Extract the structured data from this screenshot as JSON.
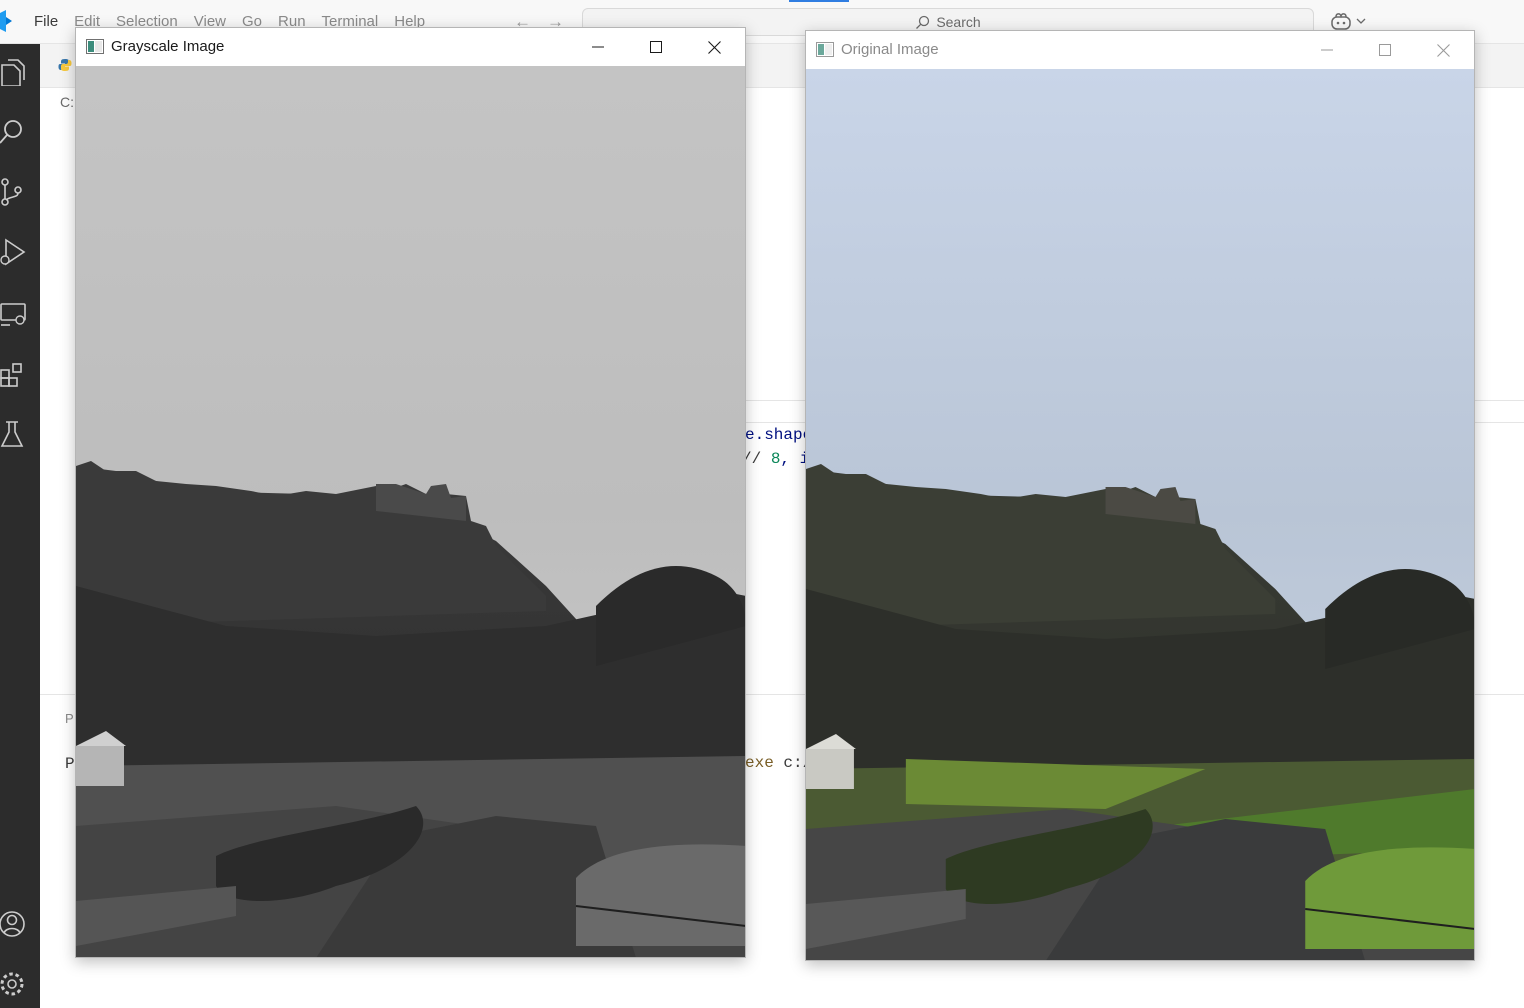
{
  "vscode": {
    "menu": [
      {
        "label": "File",
        "dim": false
      },
      {
        "label": "Edit",
        "dim": true
      },
      {
        "label": "Selection",
        "dim": true
      },
      {
        "label": "View",
        "dim": true
      },
      {
        "label": "Go",
        "dim": true
      },
      {
        "label": "Run",
        "dim": true
      },
      {
        "label": "Terminal",
        "dim": true
      },
      {
        "label": "Help",
        "dim": true
      }
    ],
    "back_arrow": "←",
    "forward_arrow": "→",
    "search_placeholder": "Search",
    "breadcrumb_fragment": "C:",
    "code_line1_fragment": "e.shape",
    "code_line2_op": "// ",
    "code_line2_num": "8",
    "code_line2_tail": ", i",
    "panel_label_fragment": "P",
    "terminal_prefix": "P",
    "terminal_exe_fragment": "exe",
    "terminal_path_fragment": " c:/",
    "accent": "#2f7de1",
    "activity_icons": [
      "explorer-icon",
      "search-icon",
      "source-control-icon",
      "run-debug-icon",
      "remote-explorer-icon",
      "extensions-icon",
      "testing-icon",
      "accounts-icon",
      "settings-gear-icon"
    ]
  },
  "windows": [
    {
      "id": "gray",
      "title": "Grayscale Image",
      "active": true,
      "grayscale": true
    },
    {
      "id": "orig",
      "title": "Original Image",
      "active": false,
      "grayscale": false
    }
  ],
  "window_controls": {
    "minimize": "minimize-icon",
    "maximize": "maximize-icon",
    "close": "close-icon"
  }
}
